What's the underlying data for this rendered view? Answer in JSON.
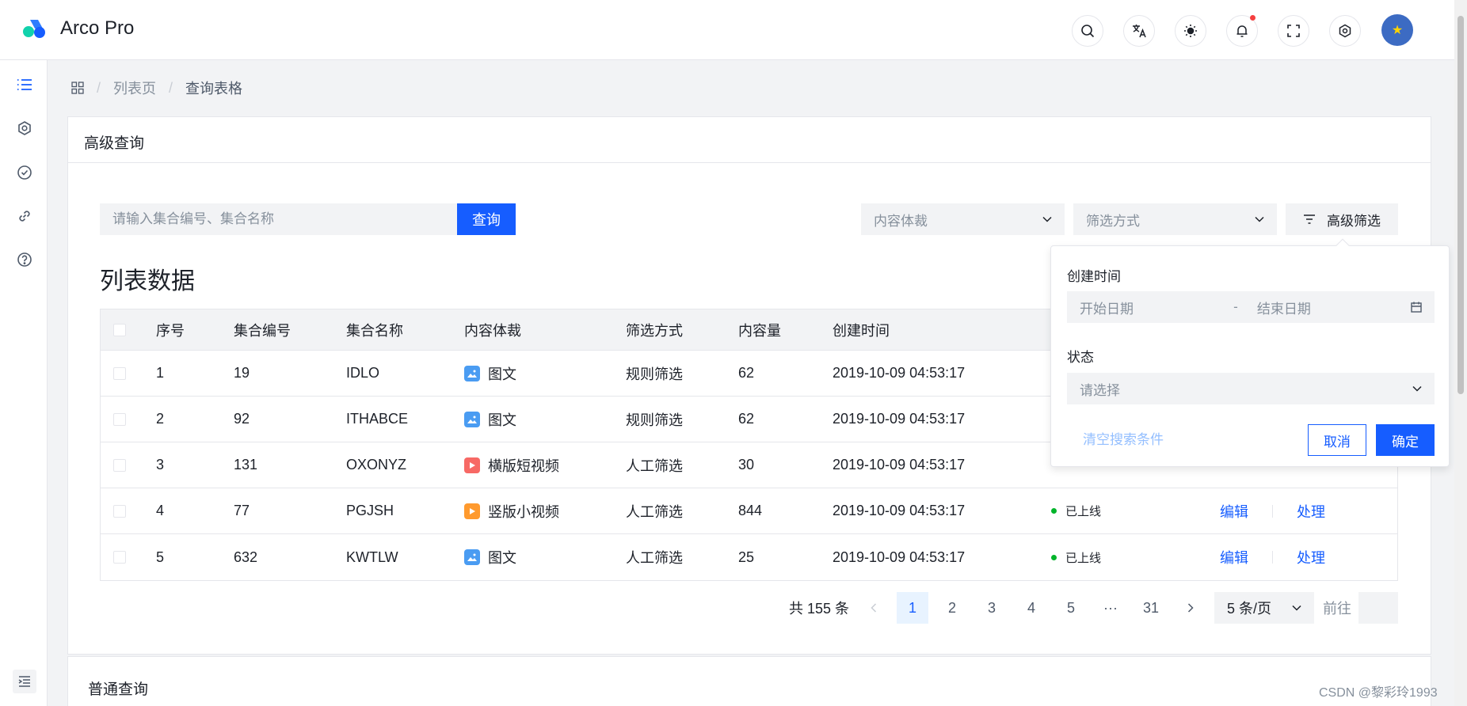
{
  "app": {
    "title": "Arco Pro"
  },
  "navbar": {
    "icons": [
      "search-icon",
      "translate-icon",
      "theme-icon",
      "notification-icon",
      "fullscreen-icon",
      "settings-icon"
    ]
  },
  "sidebar": {
    "items": [
      "list-icon",
      "settings-icon",
      "check-circle-icon",
      "link-icon",
      "question-icon"
    ],
    "active": "list-icon"
  },
  "breadcrumb": {
    "level1": "列表页",
    "level2": "查询表格"
  },
  "advanced": {
    "title": "高级查询",
    "search_placeholder": "请输入集合编号、集合名称",
    "search_button": "查询",
    "filter_content_placeholder": "内容体裁",
    "filter_method_placeholder": "筛选方式",
    "advanced_filter_label": "高级筛选",
    "list_title": "列表数据"
  },
  "table": {
    "columns": [
      "序号",
      "集合编号",
      "集合名称",
      "内容体裁",
      "筛选方式",
      "内容量",
      "创建时间"
    ],
    "rows": [
      {
        "index": "1",
        "code": "19",
        "name": "IDLO",
        "content_type": "图文",
        "content_icon": "image-icon",
        "method": "规则筛选",
        "count": "62",
        "created": "2019-10-09 04:53:17",
        "status": "",
        "edit": "",
        "handle": ""
      },
      {
        "index": "2",
        "code": "92",
        "name": "ITHABCE",
        "content_type": "图文",
        "content_icon": "image-icon",
        "method": "规则筛选",
        "count": "62",
        "created": "2019-10-09 04:53:17",
        "status": "",
        "edit": "",
        "handle": ""
      },
      {
        "index": "3",
        "code": "131",
        "name": "OXONYZ",
        "content_type": "横版短视频",
        "content_icon": "horizontal-video-icon",
        "method": "人工筛选",
        "count": "30",
        "created": "2019-10-09 04:53:17",
        "status": "",
        "edit": "",
        "handle": ""
      },
      {
        "index": "4",
        "code": "77",
        "name": "PGJSH",
        "content_type": "竖版小视频",
        "content_icon": "vertical-video-icon",
        "method": "人工筛选",
        "count": "844",
        "created": "2019-10-09 04:53:17",
        "status": "已上线",
        "edit": "编辑",
        "handle": "处理"
      },
      {
        "index": "5",
        "code": "632",
        "name": "KWTLW",
        "content_type": "图文",
        "content_icon": "image-icon",
        "method": "人工筛选",
        "count": "25",
        "created": "2019-10-09 04:53:17",
        "status": "已上线",
        "edit": "编辑",
        "handle": "处理"
      }
    ]
  },
  "pagination": {
    "total": "共 155 条",
    "pages": [
      "1",
      "2",
      "3",
      "4",
      "5",
      "···",
      "31"
    ],
    "current": "1",
    "page_size": "5 条/页",
    "goto_label": "前往"
  },
  "popover": {
    "created_label": "创建时间",
    "start_placeholder": "开始日期",
    "range_separator": "-",
    "end_placeholder": "结束日期",
    "status_label": "状态",
    "status_placeholder": "请选择",
    "clear_label": "清空搜索条件",
    "cancel_label": "取消",
    "ok_label": "确定"
  },
  "normal": {
    "title": "普通查询"
  },
  "watermark": "CSDN @黎彩玲1993",
  "colors": {
    "primary": "#165dff",
    "success": "#00b42a",
    "background": "#f2f3f5",
    "border": "#e5e6eb"
  }
}
